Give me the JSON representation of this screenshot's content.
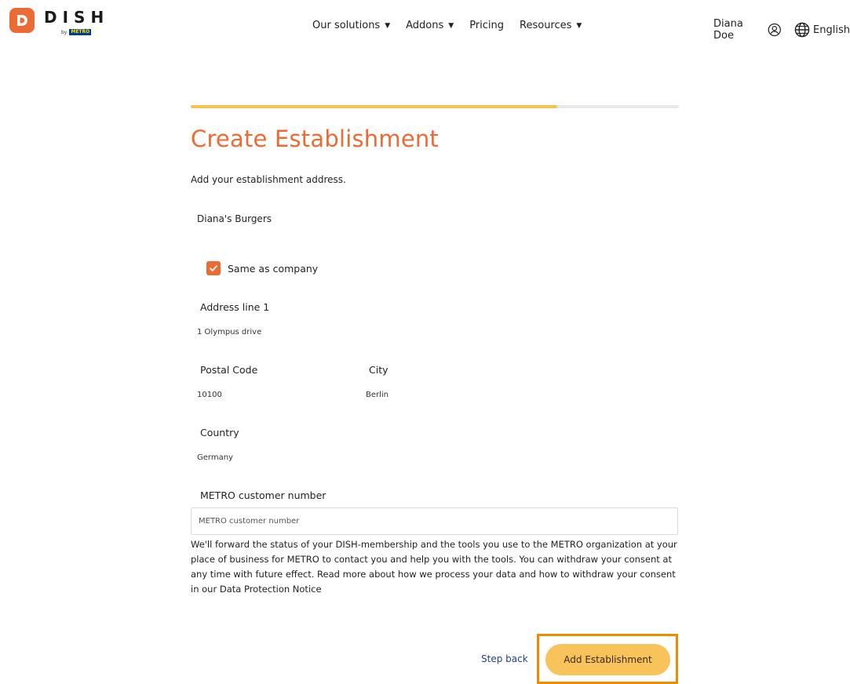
{
  "header": {
    "logo_text": "DISH",
    "logo_by": "by",
    "logo_partner": "METRO",
    "nav": [
      {
        "label": "Our solutions",
        "has_dropdown": true
      },
      {
        "label": "Addons",
        "has_dropdown": true
      },
      {
        "label": "Pricing",
        "has_dropdown": false
      },
      {
        "label": "Resources",
        "has_dropdown": true
      }
    ],
    "user_name": "Diana Doe",
    "language": "English"
  },
  "progress": {
    "fraction": 0.75,
    "color": "#f6c453"
  },
  "form": {
    "title": "Create Establishment",
    "subtitle": "Add your establishment address.",
    "establishment_name": "Diana's Burgers",
    "same_as_company": {
      "label": "Same as company",
      "checked": true
    },
    "address_line1": {
      "label": "Address line 1",
      "value": "1 Olympus drive"
    },
    "postal_code": {
      "label": "Postal Code",
      "value": "10100"
    },
    "city": {
      "label": "City",
      "value": "Berlin"
    },
    "country": {
      "label": "Country",
      "value": "Germany"
    },
    "metro_number": {
      "label": "METRO customer number",
      "placeholder": "METRO customer number",
      "value": ""
    },
    "consent_text": "We'll forward the status of your DISH-membership and the tools you use to the METRO organization at your place of business for METRO to contact you and help you with the tools. You can withdraw your consent at any time with future effect. Read more about how we process your data and how to withdraw your consent in our Data Protection Notice"
  },
  "actions": {
    "step_back": "Step back",
    "submit": "Add Establishment"
  },
  "colors": {
    "brand_orange": "#ec6a33",
    "button_yellow": "#f8c35a",
    "highlight_orange": "#f08a00",
    "link_blue": "#1f3f8f"
  },
  "icons": {
    "logo": "dish-logo-icon",
    "user": "user-circle-icon",
    "language": "globe-icon",
    "checkbox": "checkmark-icon"
  }
}
